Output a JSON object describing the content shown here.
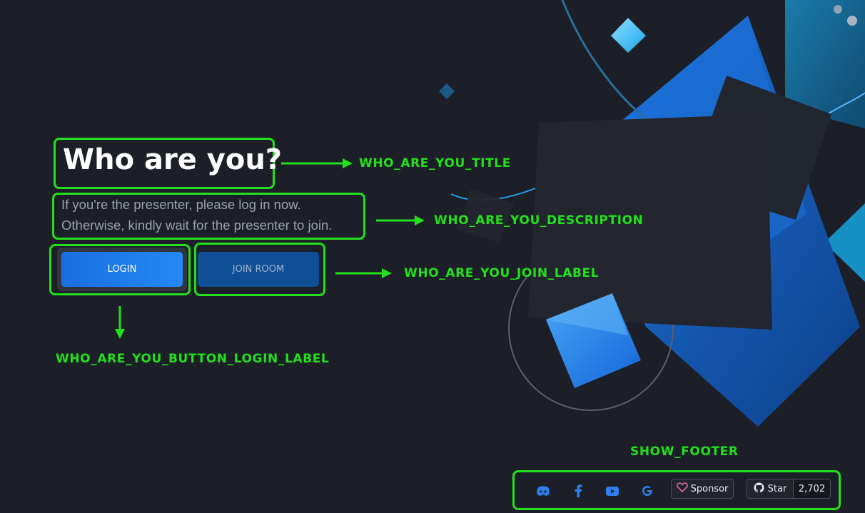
{
  "title": "Who are you?",
  "description": {
    "line1": "If you're the presenter, please log in now.",
    "line2": "Otherwise, kindly wait for the presenter to join."
  },
  "buttons": {
    "login_label": "LOGIN",
    "join_label": "JOIN ROOM"
  },
  "annotations": {
    "title_label": "WHO_ARE_YOU_TITLE",
    "description_label": "WHO_ARE_YOU_DESCRIPTION",
    "join_label": "WHO_ARE_YOU_JOIN_LABEL",
    "login_label": "WHO_ARE_YOU_BUTTON_LOGIN_LABEL",
    "footer_label": "SHOW_FOOTER"
  },
  "footer": {
    "icons": [
      "discord-icon",
      "facebook-icon",
      "youtube-icon",
      "google-icon"
    ],
    "sponsor_label": "Sponsor",
    "star_label": "Star",
    "star_count": "2,702"
  },
  "colors": {
    "background": "#1c1f27",
    "annotation": "#22e01c",
    "primary": "#1a6fe0",
    "join_button": "#0f4f95"
  }
}
